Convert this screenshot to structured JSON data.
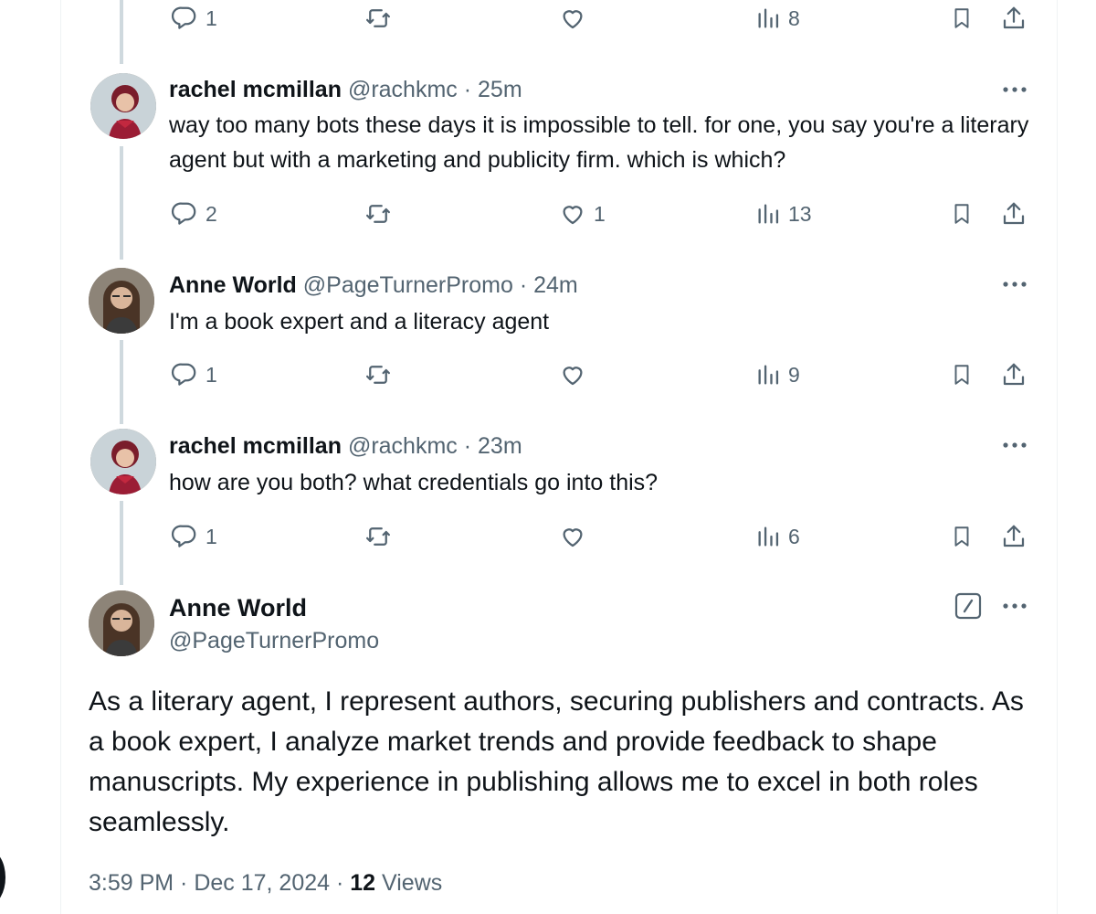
{
  "colors": {
    "text": "#0f1419",
    "muted": "#536471",
    "thread_line": "#cfd9de",
    "border": "#eff3f4"
  },
  "replies": [
    {
      "actions": {
        "reply": "1",
        "repost": "",
        "like": "",
        "views": "8"
      }
    },
    {
      "name": "rachel mcmillan",
      "handle": "@rachkmc",
      "time": "· 25m",
      "text": "way too many bots these days it is impossible to tell. for one, you say you're a literary agent but with a marketing and publicity firm. which is which?",
      "actions": {
        "reply": "2",
        "repost": "",
        "like": "1",
        "views": "13"
      }
    },
    {
      "name": "Anne World",
      "handle": "@PageTurnerPromo",
      "time": "· 24m",
      "text": "I'm a book expert and a literacy agent",
      "actions": {
        "reply": "1",
        "repost": "",
        "like": "",
        "views": "9"
      }
    },
    {
      "name": "rachel mcmillan",
      "handle": "@rachkmc",
      "time": "· 23m",
      "text": "how are you both? what credentials go into this?",
      "actions": {
        "reply": "1",
        "repost": "",
        "like": "",
        "views": "6"
      }
    }
  ],
  "main_post": {
    "name": "Anne World",
    "handle": "@PageTurnerPromo",
    "text": "As a literary agent, I represent authors, securing publishers and contracts. As a book expert, I analyze market trends and provide feedback to shape manuscripts. My experience in publishing allows me to excel in both roles seamlessly.",
    "time": "3:59 PM · Dec 17, 2024 ·",
    "views_count": "12",
    "views_label": "Views"
  },
  "icons": [
    "reply-icon",
    "repost-icon",
    "like-icon",
    "views-icon",
    "bookmark-icon",
    "share-icon",
    "more-icon",
    "edit-icon"
  ]
}
